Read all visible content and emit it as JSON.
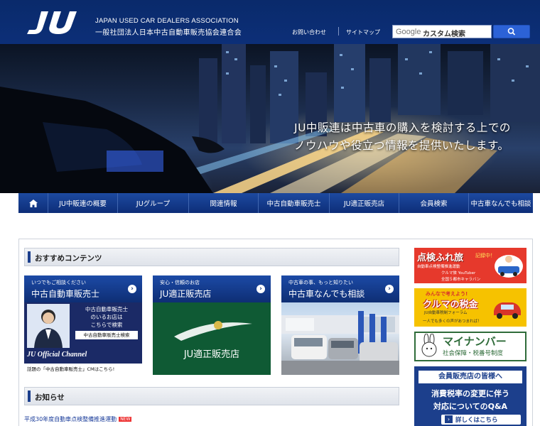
{
  "header": {
    "logo_text": "JU",
    "assoc_en": "JAPAN USED CAR DEALERS ASSOCIATION",
    "assoc_jp": "一般社団法人日本中古自動車販売協会連合会",
    "contact_label": "お問い合わせ",
    "sitemap_label": "サイトマップ",
    "search": {
      "brand": "Google",
      "placeholder": "カスタム検索"
    }
  },
  "hero": {
    "tagline_line1": "JU中販連は中古車の購入を検討する上での",
    "tagline_line2": "ノウハウや役立つ情報を提供いたします。"
  },
  "nav": {
    "home_icon": "home-icon",
    "items": [
      "JU中販連の概要",
      "JUグループ",
      "関連情報",
      "中古自動車販売士",
      "JU適正販売店",
      "会員検索",
      "中古車なんでも相談"
    ]
  },
  "recommended": {
    "heading": "おすすめコンテンツ",
    "cards": [
      {
        "sub": "いつでもご相談ください",
        "title": "中古自動車販売士",
        "img_lines": [
          "中古自動車販売士",
          "のいるお店は",
          "こちらで検索"
        ],
        "img_search": "中古自動車販売士検索",
        "img_channel": "JU Official Channel",
        "caption": "話題の「中古自動車販売士」CMはこちら!"
      },
      {
        "sub": "安心・信頼のお店",
        "title": "JU適正販売店",
        "img_label": "JU適正販売店"
      },
      {
        "sub": "中古車の事、もっと知りたい",
        "title": "中古車なんでも相談"
      }
    ]
  },
  "news": {
    "heading": "お知らせ",
    "items": [
      {
        "title": "平成30年度自動車点検整備推進運動",
        "badge": "NEW"
      }
    ]
  },
  "banners": {
    "tenken": {
      "title": "点検ふれ旅",
      "badge": "記録中！",
      "sub1": "自動車点検整備推進運動",
      "sub2": "クルマ旅 YouTuber",
      "sub3": "全国５都市キャラバン"
    },
    "zeikin": {
      "top": "みんなで考えよう!",
      "title": "クルマの税金",
      "sub": "JU自動車税制フォーラム",
      "foot": "一人でも多くの声があつまれば！"
    },
    "mynumber": {
      "title": "マイナンバー",
      "sub": "社会保障・税番号制度"
    },
    "tax": {
      "title": "会員販売店の皆様へ",
      "line1": "消費税率の変更に伴う",
      "line2": "対応についてのQ&A",
      "detail": "詳しくはこちら"
    }
  },
  "colors": {
    "brand_navy": "#0c2f78",
    "nav_blue": "#1d4aa0",
    "accent_red": "#d8352a"
  }
}
